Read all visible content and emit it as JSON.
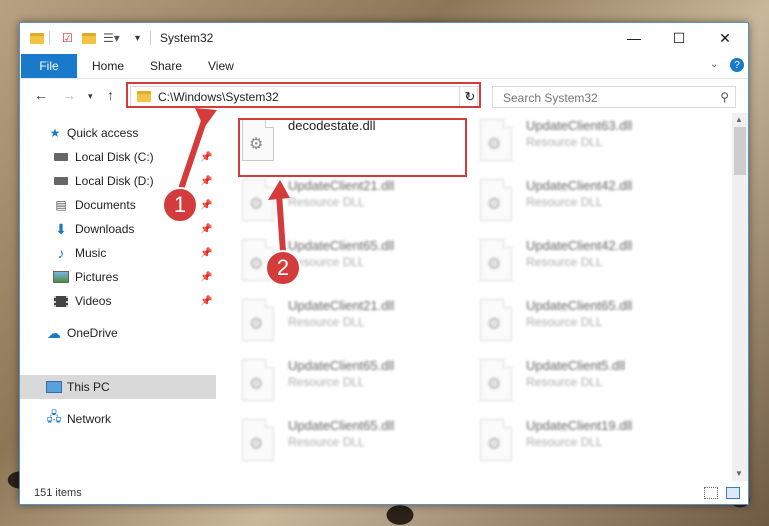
{
  "window": {
    "title": "System32"
  },
  "window_controls": {
    "minimize": "—",
    "maximize": "☐",
    "close": "✕"
  },
  "ribbon": {
    "tabs": [
      "File",
      "Home",
      "Share",
      "View"
    ]
  },
  "address": {
    "path": "C:\\Windows\\System32"
  },
  "search": {
    "placeholder": "Search System32"
  },
  "nav": {
    "items": [
      {
        "label": "Quick access",
        "icon": "star-icon"
      },
      {
        "label": "Local Disk (C:)",
        "icon": "drive-icon"
      },
      {
        "label": "Local Disk (D:)",
        "icon": "drive-icon"
      },
      {
        "label": "Documents",
        "icon": "documents-icon"
      },
      {
        "label": "Downloads",
        "icon": "downloads-icon"
      },
      {
        "label": "Music",
        "icon": "music-icon"
      },
      {
        "label": "Pictures",
        "icon": "pictures-icon"
      },
      {
        "label": "Videos",
        "icon": "videos-icon"
      },
      {
        "label": "OneDrive",
        "icon": "cloud-icon"
      },
      {
        "label": "This PC",
        "icon": "computer-icon"
      },
      {
        "label": "Network",
        "icon": "network-icon"
      }
    ]
  },
  "files": [
    {
      "name": "decodestate.dll",
      "type": ""
    },
    {
      "name": "UpdateClient63.dll",
      "type": "Resource DLL"
    },
    {
      "name": "UpdateClient21.dll",
      "type": "Resource DLL"
    },
    {
      "name": "UpdateClient42.dll",
      "type": "Resource DLL"
    },
    {
      "name": "UpdateClient65.dll",
      "type": "Resource DLL"
    },
    {
      "name": "UpdateClient42.dll",
      "type": "Resource DLL"
    },
    {
      "name": "UpdateClient21.dll",
      "type": "Resource DLL"
    },
    {
      "name": "UpdateClient65.dll",
      "type": "Resource DLL"
    },
    {
      "name": "UpdateClient65.dll",
      "type": "Resource DLL"
    },
    {
      "name": "UpdateClient5.dll",
      "type": "Resource DLL"
    },
    {
      "name": "UpdateClient65.dll",
      "type": "Resource DLL"
    },
    {
      "name": "UpdateClient19.dll",
      "type": "Resource DLL"
    }
  ],
  "status": {
    "item_count": "151 items"
  },
  "annotations": {
    "callout_1": "1",
    "callout_2": "2",
    "color": "#d43b3b"
  },
  "colors": {
    "accent": "#1979ca",
    "selection": "#d9d9d9"
  }
}
